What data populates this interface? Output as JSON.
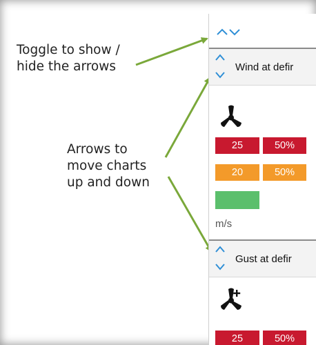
{
  "annotations": {
    "toggle_lines": [
      "Toggle to show /",
      "hide the arrows"
    ],
    "arrows_lines": [
      "Arrows to",
      "move charts",
      "up and down"
    ]
  },
  "panel": {
    "toggle_icons": [
      "chevron-up-icon",
      "chevron-down-icon"
    ],
    "charts": [
      {
        "title": "Wind at defir",
        "icon": "fan-icon",
        "rows": [
          {
            "values": [
              "25",
              "50%"
            ],
            "color": "#c8192f"
          },
          {
            "values": [
              "20",
              "50%"
            ],
            "color": "#f39a2a"
          },
          {
            "values": [],
            "color": "#5bbf6c"
          }
        ],
        "unit": "m/s"
      },
      {
        "title": "Gust at defir",
        "icon": "fan-plus-icon",
        "rows": [
          {
            "values": [
              "25",
              "50%"
            ],
            "color": "#c8192f"
          }
        ]
      }
    ]
  },
  "colors": {
    "annotation_arrow": "#7aa83a",
    "chevron": "#2f8fd6"
  }
}
